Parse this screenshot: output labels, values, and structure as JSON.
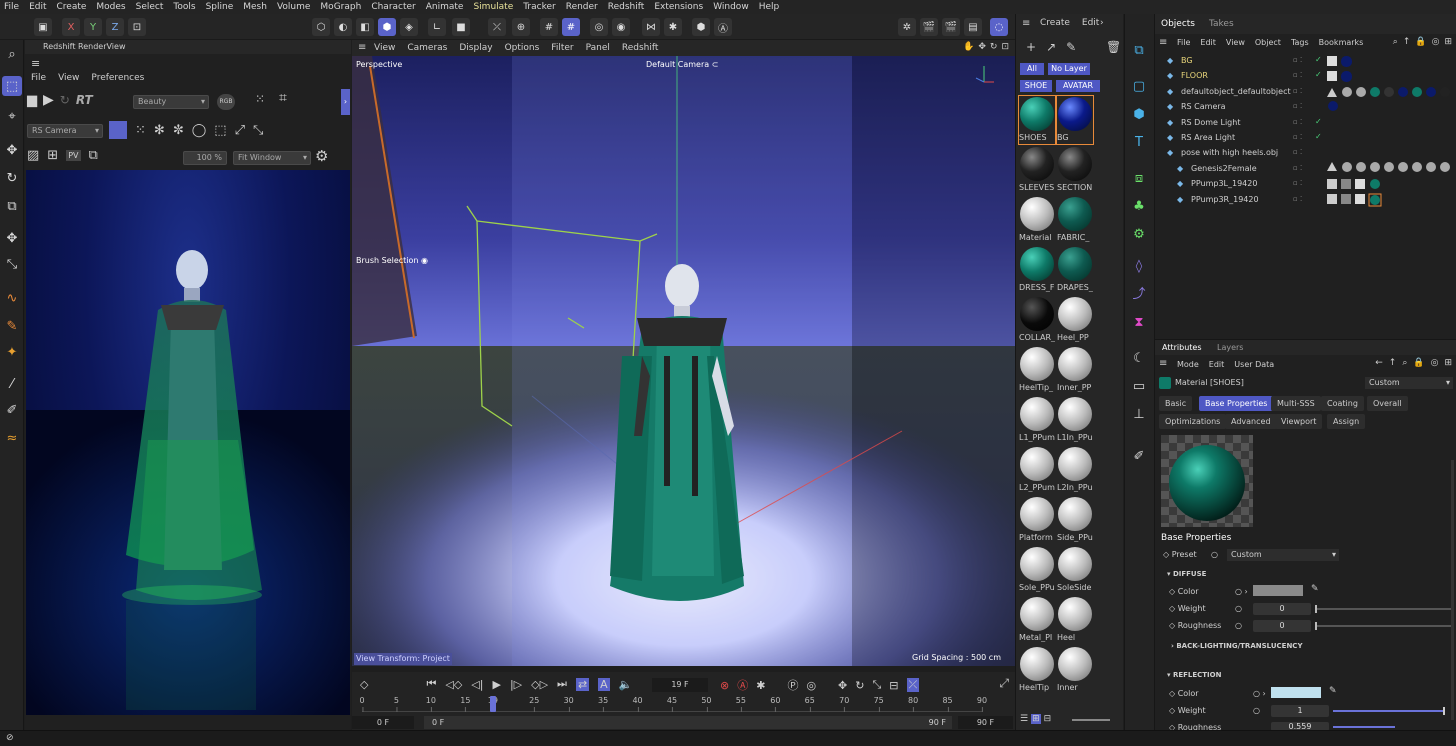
{
  "menubar": [
    "File",
    "Edit",
    "Create",
    "Modes",
    "Select",
    "Tools",
    "Spline",
    "Mesh",
    "Volume",
    "MoGraph",
    "Character",
    "Animate",
    "Simulate",
    "Tracker",
    "Render",
    "Redshift",
    "Extensions",
    "Window",
    "Help"
  ],
  "menubar_active": "Simulate",
  "axes": {
    "x": "X",
    "y": "Y",
    "z": "Z"
  },
  "renderview": {
    "title": "Redshift RenderView",
    "menu": [
      "File",
      "View",
      "Preferences"
    ],
    "rt": "RT",
    "pass": "Beauty",
    "rgb": "RGB",
    "camera": "RS Camera",
    "zoom": "100 %",
    "fit": "Fit Window",
    "pv": "PV"
  },
  "viewport": {
    "menu": [
      "View",
      "Cameras",
      "Display",
      "Options",
      "Filter",
      "Panel",
      "Redshift"
    ],
    "label": "Perspective",
    "camera": "Default Camera",
    "brush": "Brush Selection",
    "view_transform": "View Transform: Project",
    "grid": "Grid Spacing : 500 cm"
  },
  "timeline": {
    "frame": "19 F",
    "ticks": [
      "0",
      "5",
      "10",
      "15",
      "19",
      "25",
      "30",
      "35",
      "40",
      "45",
      "50",
      "55",
      "60",
      "65",
      "70",
      "75",
      "80",
      "85",
      "90"
    ],
    "start": "0 F",
    "start2": "0 F",
    "end": "90 F",
    "end2": "90 F",
    "playhead_frame": 19,
    "range_max": 90
  },
  "materials": {
    "menu": [
      "Create",
      "Edit"
    ],
    "filters": [
      "All",
      "No Layer"
    ],
    "layers": [
      "SHOE",
      "AVATAR"
    ],
    "items": [
      {
        "name": "SHOES",
        "style": "teal"
      },
      {
        "name": "BG",
        "style": "blue"
      },
      {
        "name": "SLEEVES",
        "style": "dark"
      },
      {
        "name": "SECTION",
        "style": "dark"
      },
      {
        "name": "Material",
        "style": "grey"
      },
      {
        "name": "FABRIC_",
        "style": "tealck"
      },
      {
        "name": "DRESS_F",
        "style": "teal"
      },
      {
        "name": "DRAPES_",
        "style": "tealck"
      },
      {
        "name": "COLLAR_",
        "style": "black"
      },
      {
        "name": "Heel_PP",
        "style": "grey"
      },
      {
        "name": "HeelTip_",
        "style": "grey"
      },
      {
        "name": "Inner_PP",
        "style": "grey"
      },
      {
        "name": "L1_PPum",
        "style": "grey"
      },
      {
        "name": "L1In_PPu",
        "style": "grey"
      },
      {
        "name": "L2_PPum",
        "style": "grey"
      },
      {
        "name": "L2In_PPu",
        "style": "grey"
      },
      {
        "name": "Platform",
        "style": "grey"
      },
      {
        "name": "Side_PPu",
        "style": "grey"
      },
      {
        "name": "Sole_PPu",
        "style": "grey"
      },
      {
        "name": "SoleSide",
        "style": "grey"
      },
      {
        "name": "Metal_PI",
        "style": "grey"
      },
      {
        "name": "Heel",
        "style": "grey"
      },
      {
        "name": "HeelTip",
        "style": "grey"
      },
      {
        "name": "Inner",
        "style": "grey"
      }
    ]
  },
  "objects": {
    "tabs": [
      "Objects",
      "Takes"
    ],
    "menu": [
      "File",
      "Edit",
      "View",
      "Object",
      "Tags",
      "Bookmarks"
    ],
    "rows": [
      {
        "name": "BG",
        "indent": 0,
        "color": "#e8d57a",
        "check": true
      },
      {
        "name": "FLOOR",
        "indent": 0,
        "color": "#e8d57a",
        "check": true
      },
      {
        "name": "defaultobject_defaultobject",
        "indent": 0,
        "color": "#cfcfcf",
        "check": false
      },
      {
        "name": "RS Camera",
        "indent": 0,
        "color": "#cfcfcf",
        "check": false
      },
      {
        "name": "RS Dome Light",
        "indent": 0,
        "color": "#cfcfcf",
        "check": true
      },
      {
        "name": "RS Area Light",
        "indent": 0,
        "color": "#cfcfcf",
        "check": true
      },
      {
        "name": "pose with high heels.obj",
        "indent": 0,
        "color": "#cfcfcf",
        "check": false
      },
      {
        "name": "Genesis2Female",
        "indent": 1,
        "color": "#cfcfcf",
        "check": false
      },
      {
        "name": "PPump3L_19420",
        "indent": 1,
        "color": "#cfcfcf",
        "check": false
      },
      {
        "name": "PPump3R_19420",
        "indent": 1,
        "color": "#cfcfcf",
        "check": false
      }
    ]
  },
  "attributes": {
    "tabs": [
      "Attributes",
      "Layers"
    ],
    "menu": [
      "Mode",
      "Edit",
      "User Data"
    ],
    "material": "Material [SHOES]",
    "preset_top": "Custom",
    "subtabs": [
      "Basic",
      "Base Properties",
      "Multi-SSS",
      "Coating",
      "Overall"
    ],
    "subtabs2": [
      "Optimizations",
      "Advanced",
      "Viewport",
      "Assign"
    ],
    "section": "Base Properties",
    "preset_label": "Preset",
    "preset": "Custom",
    "diffuse": "DIFFUSE",
    "color_label": "Color",
    "weight_label": "Weight",
    "weight": "0",
    "rough_label": "Roughness",
    "rough": "0",
    "backlight": "BACK-LIGHTING/TRANSLUCENCY",
    "reflection": "REFLECTION",
    "r_color_label": "Color",
    "r_weight_label": "Weight",
    "r_weight": "1",
    "r_rough_label": "Roughness",
    "r_rough": "0.559",
    "diffuse_color": "#8a8a8a",
    "reflection_color": "#bfe0ee"
  },
  "colors": {
    "accent": "#5a63c9",
    "teal": "#0e7a68"
  }
}
